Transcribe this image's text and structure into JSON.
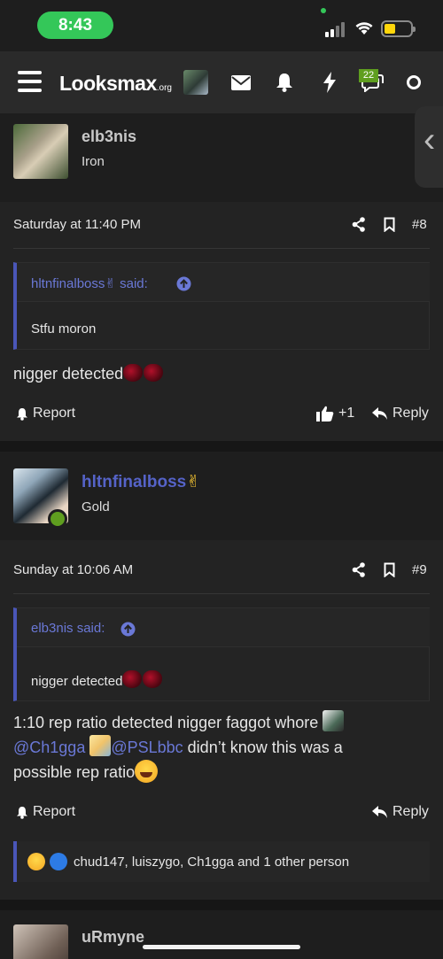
{
  "status_bar": {
    "time": "8:43"
  },
  "header": {
    "logo": "Looksmax",
    "logo_suffix": ".org",
    "notification_badge": "22",
    "icons": [
      "menu-icon",
      "envelope-icon",
      "bell-icon",
      "lightning-icon",
      "chat-bubbles-icon",
      "circle-icon"
    ]
  },
  "posts": [
    {
      "author": "elb3nis",
      "rank": "Iron",
      "date": "Saturday at 11:40 PM",
      "number": "#8",
      "quote_author": "hltnfinalboss✌ said:",
      "quote_text": "Stfu moron",
      "body": "nigger detected",
      "report_label": "Report",
      "like_count": "+1",
      "reply_label": "Reply"
    },
    {
      "author": "hltnfinalboss",
      "author_emoji": "✌",
      "rank": "Gold",
      "date": "Sunday at 10:06 AM",
      "number": "#9",
      "quote_author": "elb3nis said:",
      "quote_text": "nigger detected",
      "body_line1": "1:10 rep ratio detected nigger faggot whore",
      "mention1": "@Ch1gga",
      "mention2": "@PSLbbc",
      "body_line2_rest": " didn’t know this was a",
      "body_line3": "possible rep ratio",
      "report_label": "Report",
      "reply_label": "Reply",
      "reactions_text": "chud147, luiszygo, Ch1gga and 1 other person"
    },
    {
      "author": "uRmyne"
    }
  ],
  "colors": {
    "accent": "#4a56b8",
    "link": "#6a78d6",
    "online": "#5f9e1f",
    "status_green": "#34c759"
  }
}
